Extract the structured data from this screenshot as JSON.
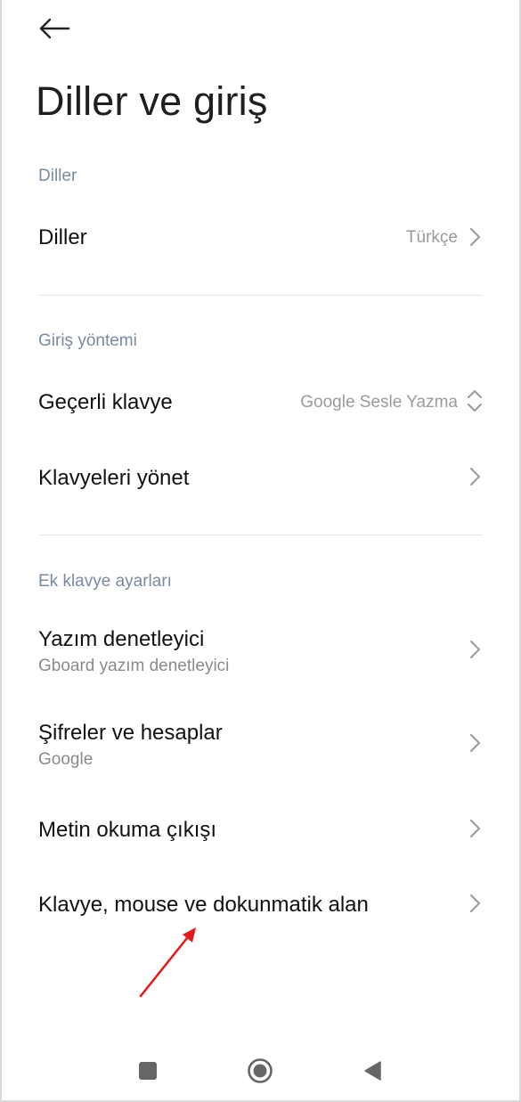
{
  "header": {
    "back_icon": "arrow-left-icon",
    "title": "Diller ve giriş"
  },
  "sections": {
    "languages": {
      "label": "Diller",
      "items": [
        {
          "title": "Diller",
          "value": "Türkçe",
          "icon": "chevron-right-icon"
        }
      ]
    },
    "input_method": {
      "label": "Giriş yöntemi",
      "items": [
        {
          "title": "Geçerli klavye",
          "value": "Google Sesle Yazma",
          "icon": "chevron-updown-icon"
        },
        {
          "title": "Klavyeleri yönet",
          "icon": "chevron-right-icon"
        }
      ]
    },
    "extra_keyboard": {
      "label": "Ek klavye ayarları",
      "items": [
        {
          "title": "Yazım denetleyici",
          "subtitle": "Gboard yazım denetleyici",
          "icon": "chevron-right-icon"
        },
        {
          "title": "Şifreler ve hesaplar",
          "subtitle": "Google",
          "icon": "chevron-right-icon"
        },
        {
          "title": "Metin okuma çıkışı",
          "icon": "chevron-right-icon"
        },
        {
          "title": "Klavye, mouse ve dokunmatik alan",
          "icon": "chevron-right-icon"
        }
      ]
    }
  },
  "navigation_bar": {
    "recents_icon": "square-icon",
    "home_icon": "circle-home-icon",
    "back_icon": "triangle-back-icon"
  },
  "annotation": {
    "icon": "red-arrow-icon",
    "color": "#e01b1b"
  },
  "colors": {
    "section_label": "#7a8aa3",
    "value_text": "#9a9a9a",
    "subtitle_text": "#8a8a8a"
  }
}
